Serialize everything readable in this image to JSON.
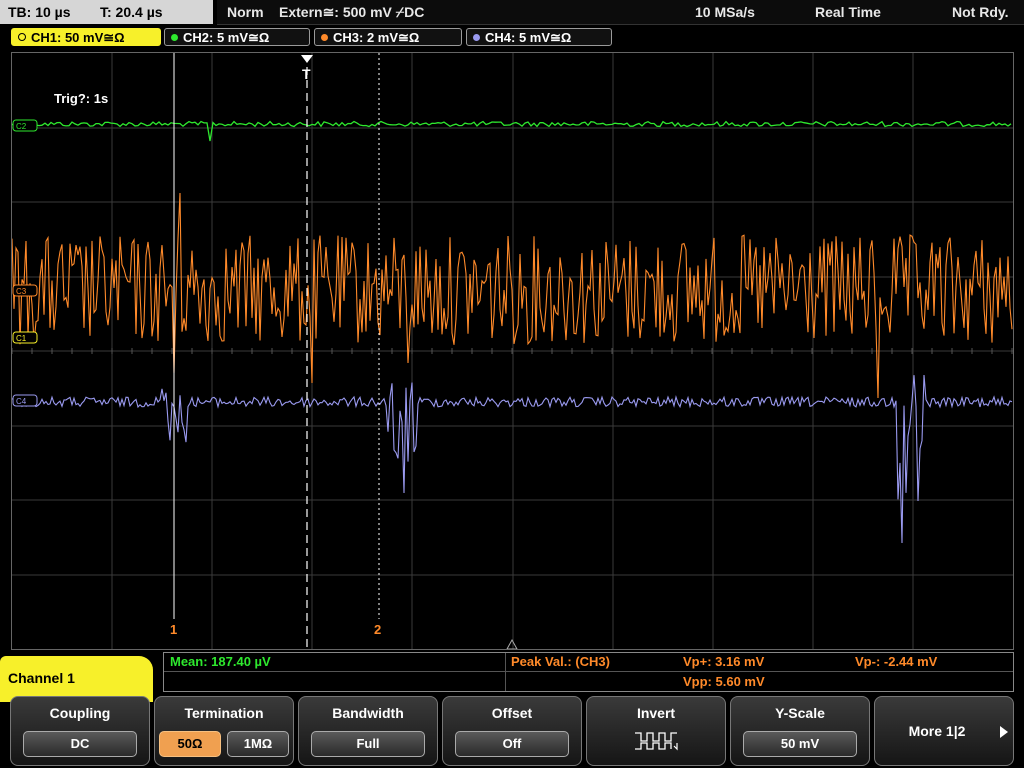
{
  "status_bar": {
    "timebase": "TB: 10 µs",
    "time": "T: 20.4 µs",
    "mode": "Norm",
    "trigger": "Extern≅: 500 mV ⌿DC",
    "sample_rate": "10 MSa/s",
    "acq": "Real Time",
    "state": "Not Rdy."
  },
  "channel_tabs": [
    {
      "label": "CH1: 50 mV≅Ω",
      "color": "#f7f02a",
      "active": true
    },
    {
      "label": "CH2: 5 mV≅Ω",
      "color": "#2ee82e",
      "active": false
    },
    {
      "label": "CH3: 2 mV≅Ω",
      "color": "#ff8a2a",
      "active": false
    },
    {
      "label": "CH4: 5 mV≅Ω",
      "color": "#9a9af0",
      "active": false
    }
  ],
  "plot": {
    "trig_info": "Trig?: 1s",
    "trigger_marker": "T",
    "cursor1": "1",
    "cursor2": "2",
    "ch_markers": [
      "C2",
      "C3",
      "C1",
      "C4"
    ]
  },
  "measurements": {
    "mean": "Mean: 187.40 µV",
    "peak_label": "Peak Val.: (CH3)",
    "vp_plus": "Vp+: 3.16 mV",
    "vp_minus": "Vp-: -2.44 mV",
    "vpp": "Vpp: 5.60 mV"
  },
  "menu": {
    "title": "Channel 1",
    "coupling": {
      "title": "Coupling",
      "value": "DC"
    },
    "termination": {
      "title": "Termination",
      "opt1": "50Ω",
      "opt2": "1MΩ"
    },
    "bandwidth": {
      "title": "Bandwidth",
      "value": "Full"
    },
    "offset": {
      "title": "Offset",
      "value": "Off"
    },
    "invert": {
      "title": "Invert"
    },
    "yscale": {
      "title": "Y-Scale",
      "value": "50 mV"
    },
    "more": "More 1|2"
  },
  "colors": {
    "ch1": "#f7f02a",
    "ch2": "#2ee82e",
    "ch3": "#ff8a2a",
    "ch4": "#9a9af0",
    "grid": "#3a3a3a"
  }
}
